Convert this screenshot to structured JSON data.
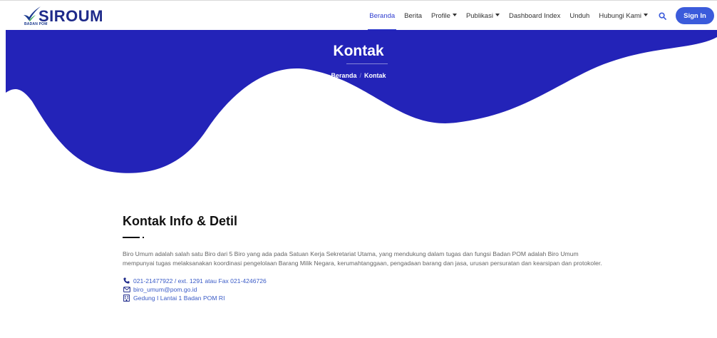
{
  "brand": {
    "name": "SIROUM",
    "sub": "BADAN POM"
  },
  "nav": {
    "items": [
      {
        "label": "Beranda",
        "active": true
      },
      {
        "label": "Berita"
      },
      {
        "label": "Profile",
        "dropdown": true
      },
      {
        "label": "Publikasi",
        "dropdown": true
      },
      {
        "label": "Dashboard Index"
      },
      {
        "label": "Unduh"
      },
      {
        "label": "Hubungi Kami",
        "dropdown": true
      }
    ],
    "search_icon": "search-icon",
    "signin_label": "Sign In"
  },
  "hero": {
    "title": "Kontak",
    "breadcrumb": [
      "Beranda",
      "/",
      "Kontak"
    ],
    "color": "#2323b8"
  },
  "section": {
    "title": "Kontak Info & Detil",
    "description": "Biro Umum adalah salah satu Biro dari 5 Biro yang ada pada Satuan Kerja Sekretariat Utama, yang mendukung dalam tugas dan fungsi Badan POM adalah Biro Umum mempunyai tugas melaksanakan koordinasi pengelolaan Barang Milik Negara, kerumahtanggaan, pengadaan barang dan jasa, urusan persuratan dan kearsipan dan protokoler.",
    "contacts": [
      {
        "icon": "phone-icon",
        "text": "021-21477922 / ext. 1291 atau Fax 021-4246726"
      },
      {
        "icon": "mail-icon",
        "text": "biro_umum@pom.go.id"
      },
      {
        "icon": "building-icon",
        "text": "Gedung I Lantai 1 Badan POM RI"
      }
    ]
  },
  "colors": {
    "accent": "#2e3ccf",
    "button": "#3b5bdb",
    "link": "#3a5bc7"
  }
}
